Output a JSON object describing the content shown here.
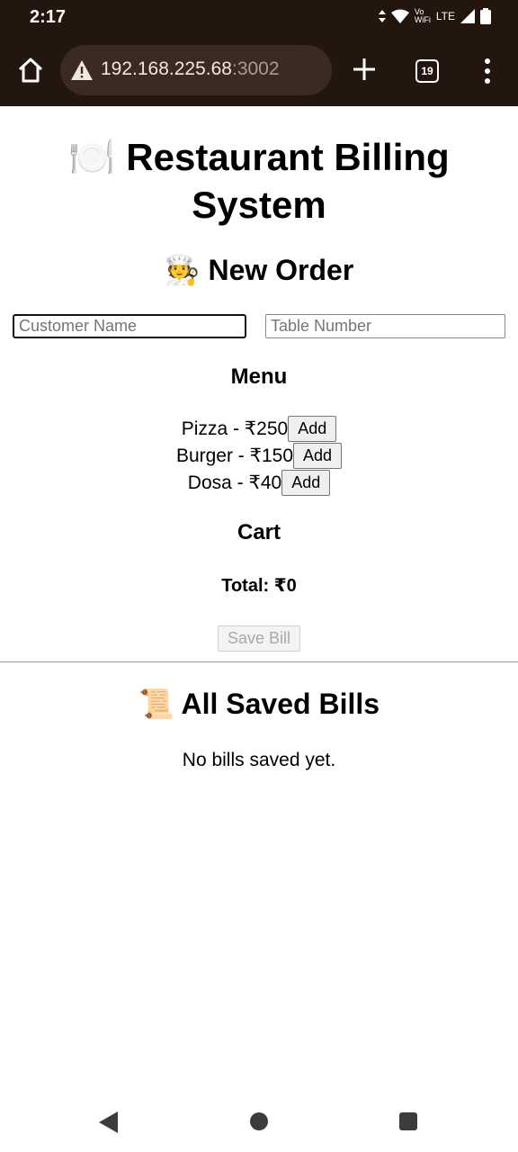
{
  "status_bar": {
    "time": "2:17",
    "network_label": "Vo WiFi",
    "lte_label": "LTE"
  },
  "browser": {
    "url_host": "192.168.225.68",
    "url_port": ":3002",
    "tab_count": "19"
  },
  "page": {
    "title": "🍽️ Restaurant Billing System",
    "new_order_heading": "🧑‍🍳 New Order",
    "customer_placeholder": "Customer Name",
    "table_placeholder": "Table Number",
    "menu_heading": "Menu",
    "menu_items": [
      {
        "label": "Pizza - ₹250",
        "button": "Add"
      },
      {
        "label": "Burger - ₹150",
        "button": "Add"
      },
      {
        "label": "Dosa - ₹40",
        "button": "Add"
      }
    ],
    "cart_heading": "Cart",
    "total_label": "Total: ₹0",
    "save_button": "Save Bill",
    "saved_heading": "📜 All Saved Bills",
    "empty_message": "No bills saved yet."
  },
  "colors": {
    "browser_chrome": "#23160f",
    "urlbar": "#3a2a21"
  }
}
